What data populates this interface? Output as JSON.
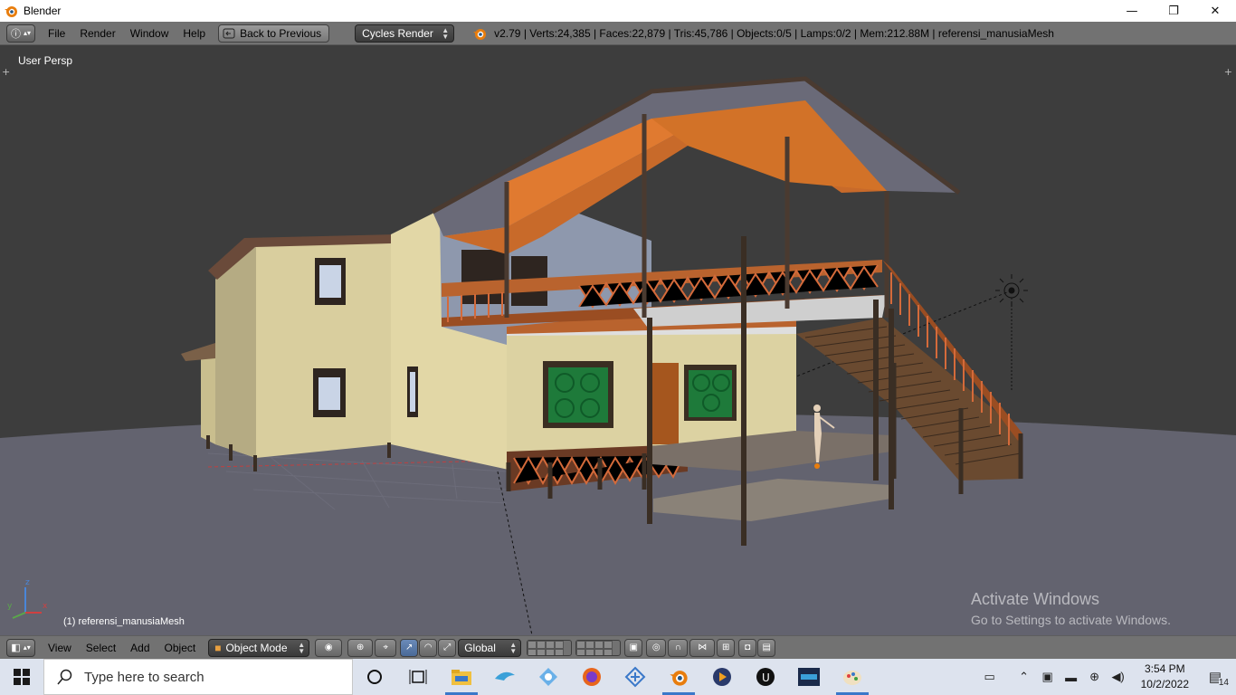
{
  "window": {
    "title": "Blender",
    "controls": {
      "minimize": "—",
      "restore": "❐",
      "close": "✕"
    }
  },
  "info_header": {
    "editor_icon": "info-icon",
    "menus": [
      "File",
      "Render",
      "Window",
      "Help"
    ],
    "back_button": "Back to Previous",
    "render_engine": "Cycles Render",
    "stats": "v2.79 | Verts:24,385 | Faces:22,879 | Tris:45,786 | Objects:0/5 | Lamps:0/2 | Mem:212.88M | referensi_manusiaMesh"
  },
  "viewport": {
    "view_label": "User Persp",
    "active_object_label": "(1) referensi_manusiaMesh",
    "axis_labels": {
      "x": "x",
      "y": "y",
      "z": "z"
    },
    "watermark_line1": "Activate Windows",
    "watermark_line2": "Go to Settings to activate Windows."
  },
  "view3d_header": {
    "menus": [
      "View",
      "Select",
      "Add",
      "Object"
    ],
    "mode": "Object Mode",
    "orientation": "Global"
  },
  "taskbar": {
    "search_placeholder": "Type here to search",
    "time": "3:54 PM",
    "date": "10/2/2022",
    "notifications": "14",
    "pinned": [
      "cortana-icon",
      "task-view-icon",
      "file-explorer-icon",
      "dolphin-app-icon",
      "puzzle-app-icon",
      "firefox-icon",
      "network-app-icon",
      "blender-icon",
      "media-player-icon",
      "unreal-engine-icon",
      "hcc-app-icon",
      "paint-app-icon"
    ]
  },
  "colors": {
    "blender_header": "#727272",
    "viewport_bg": "#3d3d3d",
    "ground": "#63636f",
    "taskbar": "#dde3ee",
    "accent": "#3a78c9"
  }
}
